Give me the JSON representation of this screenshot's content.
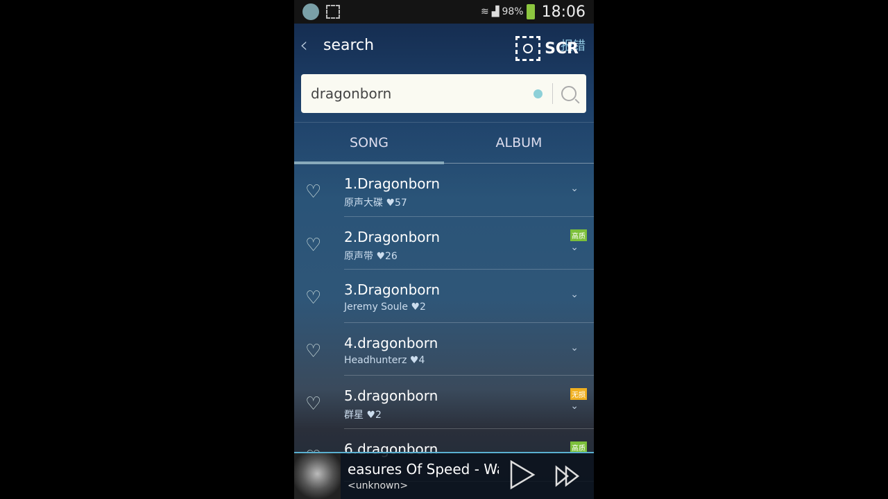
{
  "status_bar": {
    "battery": "98%",
    "time": "18:06"
  },
  "header": {
    "title": "search",
    "report": "报错",
    "scr_label": "SCR"
  },
  "search": {
    "value": "dragonborn"
  },
  "tabs": [
    {
      "label": "SONG",
      "active": true
    },
    {
      "label": "ALBUM",
      "active": false
    }
  ],
  "songs": [
    {
      "title": "1.Dragonborn",
      "artist": "原声大碟",
      "likes": "57",
      "badge": ""
    },
    {
      "title": "2.Dragonborn",
      "artist": "原声带",
      "likes": "26",
      "badge": "高质"
    },
    {
      "title": "3.Dragonborn",
      "artist": "Jeremy Soule",
      "likes": "2",
      "badge": ""
    },
    {
      "title": "4.dragonborn",
      "artist": "Headhunterz",
      "likes": "4",
      "badge": ""
    },
    {
      "title": "5.dragonborn",
      "artist": "群星",
      "likes": "2",
      "badge": "无损"
    },
    {
      "title": "6.dragonborn",
      "artist": "",
      "likes": "",
      "badge": "高质"
    }
  ],
  "player": {
    "title": "easures Of Speed - Wa",
    "artist": "<unknown>"
  },
  "colors": {
    "accent": "#5ab0d0",
    "badge_hq": "#7cc03a",
    "badge_lossless": "#f0b020"
  }
}
